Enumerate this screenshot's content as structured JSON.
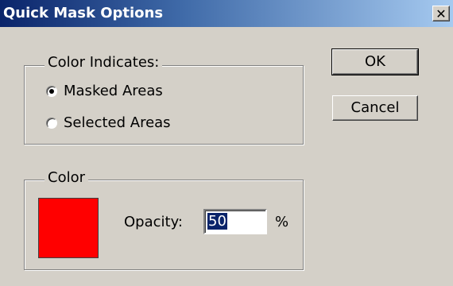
{
  "window": {
    "title": "Quick Mask Options",
    "close_glyph": "✕"
  },
  "color_indicates": {
    "legend": "Color Indicates:",
    "options": [
      {
        "label": "Masked Areas",
        "selected": true
      },
      {
        "label": "Selected Areas",
        "selected": false
      }
    ]
  },
  "color_group": {
    "legend": "Color",
    "swatch_color": "#ff0000",
    "opacity_label": "Opacity:",
    "opacity_value": "50",
    "opacity_unit": "%"
  },
  "buttons": {
    "ok": "OK",
    "cancel": "Cancel"
  }
}
